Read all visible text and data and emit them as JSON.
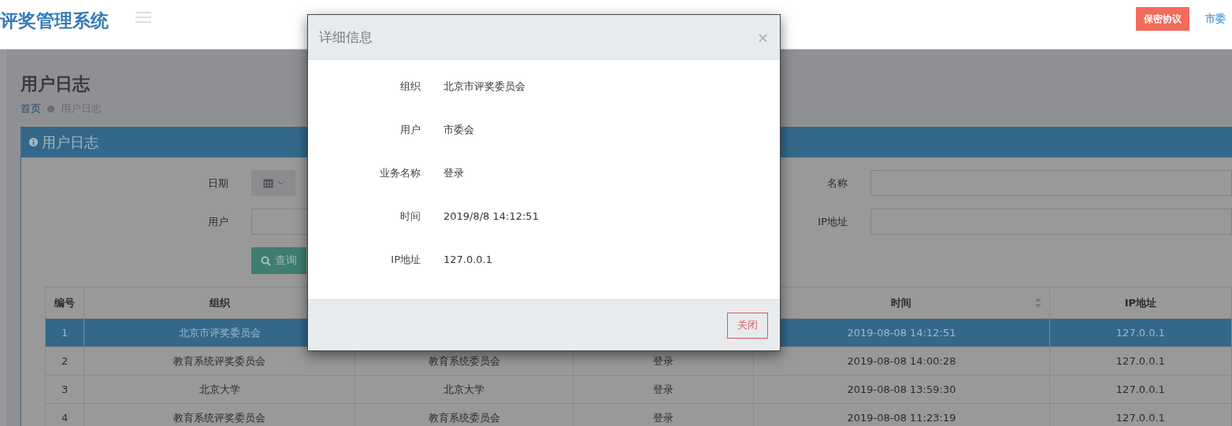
{
  "header": {
    "app_title": "评奖管理系统",
    "agreement_button": "保密协议",
    "user_link": "市委"
  },
  "page": {
    "title": "用户日志",
    "breadcrumb": [
      {
        "label": "首页",
        "link": true
      },
      {
        "label": "用户日志",
        "link": false
      }
    ]
  },
  "panel": {
    "title": "用户日志",
    "filters": [
      {
        "kind": "date",
        "label": "日期"
      },
      {
        "kind": "text",
        "label": "名称"
      },
      {
        "kind": "text",
        "label": "用户"
      },
      {
        "kind": "text",
        "label": "IP地址"
      }
    ],
    "search_button": "查询"
  },
  "table": {
    "columns": [
      {
        "label": "编号"
      },
      {
        "label": "组织"
      },
      null,
      null,
      {
        "label": "时间",
        "sortable": true
      },
      {
        "label": "IP地址"
      }
    ],
    "rows": [
      {
        "selected": true,
        "cells": [
          "1",
          "北京市评奖委员会",
          null,
          null,
          "2019-08-08 14:12:51",
          "127.0.0.1"
        ]
      },
      {
        "selected": false,
        "cells": [
          "2",
          "教育系统评奖委员会",
          "教育系统委员会",
          "登录",
          "2019-08-08 14:00:28",
          "127.0.0.1"
        ]
      },
      {
        "selected": false,
        "cells": [
          "3",
          "北京大学",
          "北京大学",
          "登录",
          "2019-08-08 13:59:30",
          "127.0.0.1"
        ]
      },
      {
        "selected": false,
        "cells": [
          "4",
          "教育系统评奖委员会",
          "教育系统委员会",
          "登录",
          "2019-08-08 11:23:19",
          "127.0.0.1"
        ]
      }
    ]
  },
  "dialog": {
    "title": "详细信息",
    "close_icon": "×",
    "fields": [
      {
        "label": "组织",
        "value": "北京市评奖委员会"
      },
      {
        "label": "用户",
        "value": "市委会"
      },
      {
        "label": "业务名称",
        "value": "登录"
      },
      {
        "label": "时间",
        "value": "2019/8/8 14:12:51"
      },
      {
        "label": "IP地址",
        "value": "127.0.0.1"
      }
    ],
    "close_button": "关闭"
  }
}
